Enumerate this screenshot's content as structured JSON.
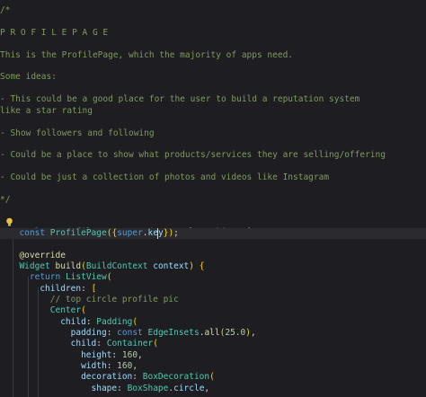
{
  "lines": [
    {
      "t": "/*"
    },
    {
      "t": ""
    },
    {
      "t": "P R O F I L E P A G E"
    },
    {
      "t": ""
    },
    {
      "t": "This is the ProfilePage, which the majority of apps need."
    },
    {
      "t": ""
    },
    {
      "t": "Some ideas:"
    },
    {
      "t": ""
    },
    {
      "t": "- This could be a good place for the user to build a reputation system"
    },
    {
      "t": "like a star rating"
    },
    {
      "t": ""
    },
    {
      "t": "- Show followers and following"
    },
    {
      "t": ""
    },
    {
      "t": "- Could be a place to show what products/services they are selling/offering"
    },
    {
      "t": ""
    },
    {
      "t": "- Could be just a collection of photos and videos like Instagram"
    },
    {
      "t": ""
    },
    {
      "t": "*/"
    },
    {
      "t": ""
    },
    {
      "t": "class ProfilePage extends StatelessWidget {"
    },
    {
      "t": "  const ProfilePage({super.key});"
    },
    {
      "t": ""
    },
    {
      "t": "  @override"
    },
    {
      "t": "  Widget build(BuildContext context) {"
    },
    {
      "t": "    return ListView("
    },
    {
      "t": "      children: ["
    },
    {
      "t": "        // top circle profile pic"
    },
    {
      "t": "        Center("
    },
    {
      "t": "          child: Padding("
    },
    {
      "t": "            padding: const EdgeInsets.all(25.0),"
    },
    {
      "t": "            child: Container("
    },
    {
      "t": "              height: 160,"
    },
    {
      "t": "              width: 160,"
    },
    {
      "t": "              decoration: BoxDecoration("
    },
    {
      "t": "                shape: BoxShape.circle,"
    }
  ],
  "icons": {
    "lightbulb": "lightbulb-icon"
  },
  "colors": {
    "background": "#1e1e22",
    "comment": "#7f9a5c",
    "keyword": "#c586c0",
    "type": "#4ec9b0",
    "number": "#b5cea8"
  }
}
